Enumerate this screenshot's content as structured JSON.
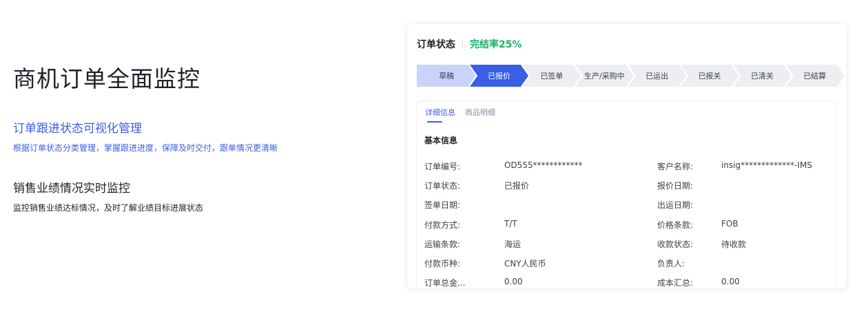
{
  "hero": {
    "title": "商机订单全面监控"
  },
  "features": [
    {
      "title": "订单跟进状态可视化管理",
      "desc": "根据订单状态分类管理，掌握跟进进度，保障及时交付，跟单情况更清晰"
    },
    {
      "title": "销售业绩情况实时监控",
      "desc": "监控销售业绩达标情况，及时了解业绩目标进展状态"
    }
  ],
  "card": {
    "title": "订单状态",
    "completion": "完结率25%",
    "steps": [
      "草稿",
      "已报价",
      "已签单",
      "生产/采购中",
      "已运出",
      "已报关",
      "已清关",
      "已结算"
    ],
    "current_step": 1,
    "tabs": [
      "详细信息",
      "商品明细"
    ],
    "section_title": "基本信息",
    "rows": [
      {
        "l1": "订单编号:",
        "v1": "OD555************",
        "l2": "客户名称:",
        "v2": "insig*************-IMS"
      },
      {
        "l1": "订单状态:",
        "v1": "已报价",
        "l2": "报价日期:",
        "v2": ""
      },
      {
        "l1": "签单日期:",
        "v1": "",
        "l2": "出运日期:",
        "v2": ""
      },
      {
        "l1": "付款方式:",
        "v1": "T/T",
        "l2": "价格条款:",
        "v2": "FOB"
      },
      {
        "l1": "运输条款:",
        "v1": "海运",
        "l2": "收款状态:",
        "v2": "待收款"
      },
      {
        "l1": "付款币种:",
        "v1": "CNY人民币",
        "l2": "负责人:",
        "v2": ""
      },
      {
        "l1": "订单总金...",
        "v1": "0.00",
        "l2": "成本汇总:",
        "v2": "0.00"
      }
    ]
  },
  "colors": {
    "accent": "#3b5ee6",
    "success": "#17b26a",
    "step_done": "#c9d3fb",
    "step_active": "#3b5ee6",
    "step_pending": "#eceef2"
  }
}
